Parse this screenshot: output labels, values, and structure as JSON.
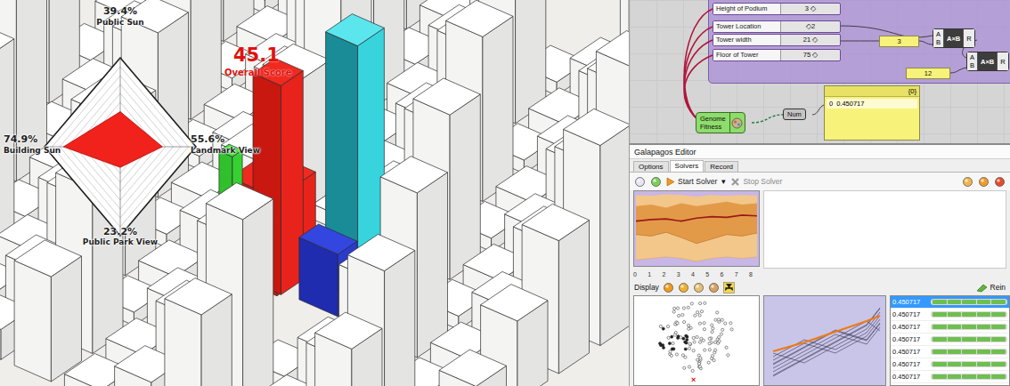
{
  "viewport": {
    "overall": {
      "value": "45.1",
      "label": "Overall Score"
    },
    "radar": [
      {
        "label": "Public Sun",
        "reading": "39.4%",
        "level": 0.394
      },
      {
        "label": "Landmark View",
        "reading": "55.6%",
        "level": 0.556
      },
      {
        "label": "Public Park View",
        "reading": "23.2%",
        "level": 0.232
      },
      {
        "label": "Building Sun",
        "reading": "74.9%",
        "level": 0.749
      }
    ]
  },
  "canvas": {
    "sliders": [
      {
        "label": "Height of Podium",
        "value": "3 ◇"
      },
      {
        "label": "Tower Location",
        "value": "◇2"
      },
      {
        "label": "Tower width",
        "value": "21 ◇"
      },
      {
        "label": "Floor of Tower",
        "value": "75 ◇"
      }
    ],
    "panels": [
      {
        "text": "3"
      },
      {
        "text": "12"
      }
    ],
    "multiply": [
      {
        "inputs": [
          "A",
          "B"
        ],
        "label": "A×B",
        "output": "R"
      },
      {
        "inputs": [
          "A",
          "B"
        ],
        "label": "A×B",
        "output": "R"
      }
    ],
    "genome": {
      "labels": [
        "Genome",
        "Fitness"
      ]
    },
    "num": "Num",
    "output_panel": {
      "header": "{0}",
      "index": "0",
      "value": "0.450717"
    }
  },
  "galapagos": {
    "title": "Galapagos Editor",
    "tabs": [
      {
        "label": "Options",
        "selected": false
      },
      {
        "label": "Solvers",
        "selected": true
      },
      {
        "label": "Record",
        "selected": false
      }
    ],
    "toolbar": {
      "start": "Start Solver",
      "start_menu": "▾",
      "stop": "Stop Solver"
    },
    "chart": {
      "x_ticks": [
        "0",
        "1",
        "2",
        "3",
        "4",
        "5",
        "6",
        "7",
        "8"
      ],
      "outer_upper": [
        0.95,
        0.94,
        0.96,
        0.95,
        0.93,
        0.95,
        0.94,
        0.95,
        0.94
      ],
      "inner_upper": [
        0.8,
        0.82,
        0.78,
        0.84,
        0.8,
        0.83,
        0.86,
        0.82,
        0.84
      ],
      "mean": [
        0.6,
        0.62,
        0.63,
        0.6,
        0.64,
        0.66,
        0.65,
        0.68,
        0.67
      ],
      "inner_lower": [
        0.42,
        0.4,
        0.45,
        0.38,
        0.3,
        0.36,
        0.42,
        0.4,
        0.44
      ],
      "outer_lower": [
        0.08,
        0.1,
        0.12,
        0.1,
        0.06,
        0.1,
        0.12,
        0.1,
        0.12
      ]
    },
    "display": "Display",
    "reinstate": "Rein",
    "best_marker": "×",
    "list": [
      {
        "value": "0.450717",
        "selected": true
      },
      {
        "value": "0.450717",
        "selected": false
      },
      {
        "value": "0.450717",
        "selected": false
      },
      {
        "value": "0.450717",
        "selected": false
      },
      {
        "value": "0.450717",
        "selected": false
      },
      {
        "value": "0.450717",
        "selected": false
      },
      {
        "value": "0.450717",
        "selected": false
      }
    ]
  }
}
